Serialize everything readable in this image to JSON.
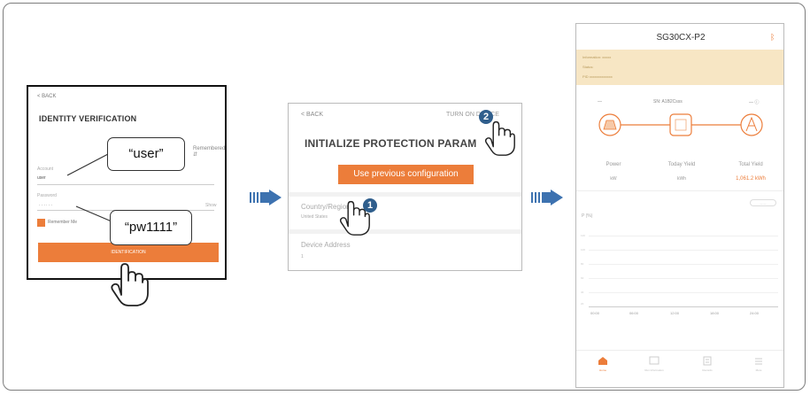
{
  "colors": {
    "accent": "#ec7d3a",
    "arrow": "#3d72b0",
    "badge": "#2f5e8c",
    "frame": "#7d7d7d"
  },
  "login_screen": {
    "back": "< BACK",
    "title": "IDENTITY VERIFICATION",
    "remembered": "Remembered",
    "account_label": "Account",
    "account_value": "user",
    "password_label": "Password",
    "password_value": "······",
    "show_label": "Show",
    "remember_label": "Remember Me",
    "login_label": "IDENTIFICATION",
    "callout_user": "“user”",
    "callout_pw": "“pw1111”"
  },
  "protection_screen": {
    "back": "< BACK",
    "turn_on": "TURN ON DEVICE",
    "title": "INITIALIZE PROTECTION PARAM",
    "use_previous": "Use previous configuration",
    "country_label": "Country/Region",
    "country_value": "United States",
    "device_address_label": "Device Address",
    "device_address_value": "1",
    "step1": "1",
    "step2": "2"
  },
  "home_screen": {
    "device_name": "SG30CX-P2",
    "banner_lines": [
      "Information: xxxxx",
      "Status:",
      "PID xxxxxxxxxxxxx"
    ],
    "sn": "SN: A1B2Csss",
    "left_top": "—",
    "right_top": "— ⓘ",
    "stats": [
      {
        "label": "Power",
        "value": "kW"
      },
      {
        "label": "Today Yield",
        "value": "kWh"
      },
      {
        "label": "Total Yield",
        "value": "1,061.2 kWh"
      }
    ],
    "chart_toggle": "— —",
    "chart_unit": "P (%)",
    "y_ticks": [
      "120",
      "100",
      "80",
      "60",
      "40",
      "20"
    ],
    "x_ticks": [
      "00:00",
      "06:00",
      "12:00",
      "18:00",
      "24:00"
    ],
    "nav": [
      {
        "label": "Home",
        "icon": "home-icon"
      },
      {
        "label": "Run Information",
        "icon": "run-info-icon"
      },
      {
        "label": "Records",
        "icon": "records-icon"
      },
      {
        "label": "More",
        "icon": "more-icon"
      }
    ]
  }
}
